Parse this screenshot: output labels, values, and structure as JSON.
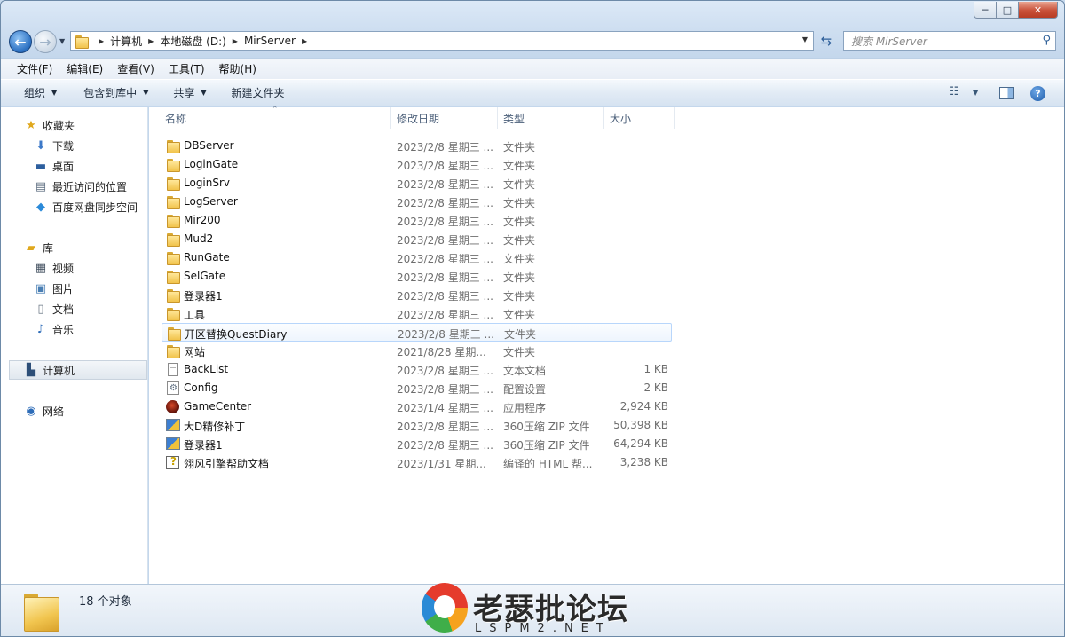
{
  "window": {
    "min_label": "─",
    "max_label": "□",
    "close_label": "✕"
  },
  "address": {
    "crumbs": [
      "计算机",
      "本地磁盘 (D:)",
      "MirServer"
    ],
    "search_placeholder": "搜索 MirServer"
  },
  "menu": [
    "文件(F)",
    "编辑(E)",
    "查看(V)",
    "工具(T)",
    "帮助(H)"
  ],
  "toolbar": {
    "organize": "组织",
    "include_library": "包含到库中",
    "share": "共享",
    "new_folder": "新建文件夹"
  },
  "nav": {
    "favorites": "收藏夹",
    "downloads": "下载",
    "desktop": "桌面",
    "recent": "最近访问的位置",
    "baidu": "百度网盘同步空间",
    "libraries": "库",
    "videos": "视频",
    "pictures": "图片",
    "documents": "文档",
    "music": "音乐",
    "computer": "计算机",
    "network": "网络"
  },
  "columns": {
    "name": "名称",
    "date": "修改日期",
    "type": "类型",
    "size": "大小"
  },
  "files": [
    {
      "name": "DBServer",
      "date": "2023/2/8 星期三 ...",
      "type": "文件夹",
      "size": "",
      "icon": "folder-icon"
    },
    {
      "name": "LoginGate",
      "date": "2023/2/8 星期三 ...",
      "type": "文件夹",
      "size": "",
      "icon": "folder-icon"
    },
    {
      "name": "LoginSrv",
      "date": "2023/2/8 星期三 ...",
      "type": "文件夹",
      "size": "",
      "icon": "folder-icon"
    },
    {
      "name": "LogServer",
      "date": "2023/2/8 星期三 ...",
      "type": "文件夹",
      "size": "",
      "icon": "folder-icon"
    },
    {
      "name": "Mir200",
      "date": "2023/2/8 星期三 ...",
      "type": "文件夹",
      "size": "",
      "icon": "folder-icon"
    },
    {
      "name": "Mud2",
      "date": "2023/2/8 星期三 ...",
      "type": "文件夹",
      "size": "",
      "icon": "folder-icon"
    },
    {
      "name": "RunGate",
      "date": "2023/2/8 星期三 ...",
      "type": "文件夹",
      "size": "",
      "icon": "folder-icon"
    },
    {
      "name": "SelGate",
      "date": "2023/2/8 星期三 ...",
      "type": "文件夹",
      "size": "",
      "icon": "folder-icon"
    },
    {
      "name": "登录器1",
      "date": "2023/2/8 星期三 ...",
      "type": "文件夹",
      "size": "",
      "icon": "folder-icon"
    },
    {
      "name": "工具",
      "date": "2023/2/8 星期三 ...",
      "type": "文件夹",
      "size": "",
      "icon": "folder-icon"
    },
    {
      "name": "开区替换QuestDiary",
      "date": "2023/2/8 星期三 ...",
      "type": "文件夹",
      "size": "",
      "icon": "folder-icon"
    },
    {
      "name": "网站",
      "date": "2021/8/28 星期...",
      "type": "文件夹",
      "size": "",
      "icon": "folder-icon"
    },
    {
      "name": "BackList",
      "date": "2023/2/8 星期三 ...",
      "type": "文本文档",
      "size": "1 KB",
      "icon": "text-file-icon"
    },
    {
      "name": "Config",
      "date": "2023/2/8 星期三 ...",
      "type": "配置设置",
      "size": "2 KB",
      "icon": "config-file-icon"
    },
    {
      "name": "GameCenter",
      "date": "2023/1/4 星期三 ...",
      "type": "应用程序",
      "size": "2,924 KB",
      "icon": "application-icon"
    },
    {
      "name": "大D精修补丁",
      "date": "2023/2/8 星期三 ...",
      "type": "360压缩 ZIP 文件",
      "size": "50,398 KB",
      "icon": "zip-file-icon"
    },
    {
      "name": "登录器1",
      "date": "2023/2/8 星期三 ...",
      "type": "360压缩 ZIP 文件",
      "size": "64,294 KB",
      "icon": "zip-file-icon"
    },
    {
      "name": "翎风引擎帮助文档",
      "date": "2023/1/31 星期...",
      "type": "编译的 HTML 帮...",
      "size": "3,238 KB",
      "icon": "chm-help-icon"
    }
  ],
  "status": {
    "count": "18 个对象"
  },
  "watermark": {
    "title": "老瑟批论坛",
    "subtitle": "LSPM2.NET"
  }
}
